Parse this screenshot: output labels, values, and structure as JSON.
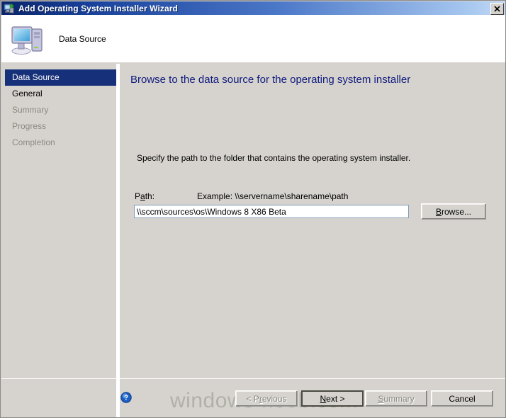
{
  "window": {
    "title": "Add Operating System Installer Wizard",
    "icon": "computer-add-icon",
    "close_label": "✕"
  },
  "banner": {
    "title": "Data Source",
    "icon": "computer-icon"
  },
  "sidebar": {
    "items": [
      {
        "label": "Data Source",
        "state": "selected"
      },
      {
        "label": "General",
        "state": "enabled"
      },
      {
        "label": "Summary",
        "state": "disabled"
      },
      {
        "label": "Progress",
        "state": "disabled"
      },
      {
        "label": "Completion",
        "state": "disabled"
      }
    ]
  },
  "content": {
    "heading": "Browse to the data source for the operating system installer",
    "instruction": "Specify the path to the folder that contains the operating system installer.",
    "path_label_pre": "P",
    "path_label_accel": "a",
    "path_label_post": "th:",
    "example_label": "Example: \\\\servername\\sharename\\path",
    "path_value": "\\\\sccm\\sources\\os\\Windows 8 X86 Beta",
    "path_placeholder": "",
    "browse_pre": "",
    "browse_accel": "B",
    "browse_post": "rowse..."
  },
  "footer": {
    "help_icon": "help-question-icon",
    "watermark": "windows-noob.com",
    "buttons": [
      {
        "name": "previous",
        "pre": "< P",
        "accel": "r",
        "post": "evious",
        "disabled": true,
        "default": false
      },
      {
        "name": "next",
        "pre": "",
        "accel": "N",
        "post": "ext >",
        "disabled": false,
        "default": true
      },
      {
        "name": "summary",
        "pre": "",
        "accel": "S",
        "post": "ummary",
        "disabled": true,
        "default": false
      },
      {
        "name": "cancel",
        "pre": "Cancel",
        "accel": "",
        "post": "",
        "disabled": false,
        "default": false
      }
    ]
  },
  "colors": {
    "titlebar_start": "#0a246a",
    "titlebar_end": "#c3d9f5",
    "dialog_face": "#d6d3ce",
    "heading_blue": "#0e197c",
    "selection_navy": "#16307a",
    "disabled_text": "#898980",
    "watermark_gray": "#b1b0a8"
  }
}
